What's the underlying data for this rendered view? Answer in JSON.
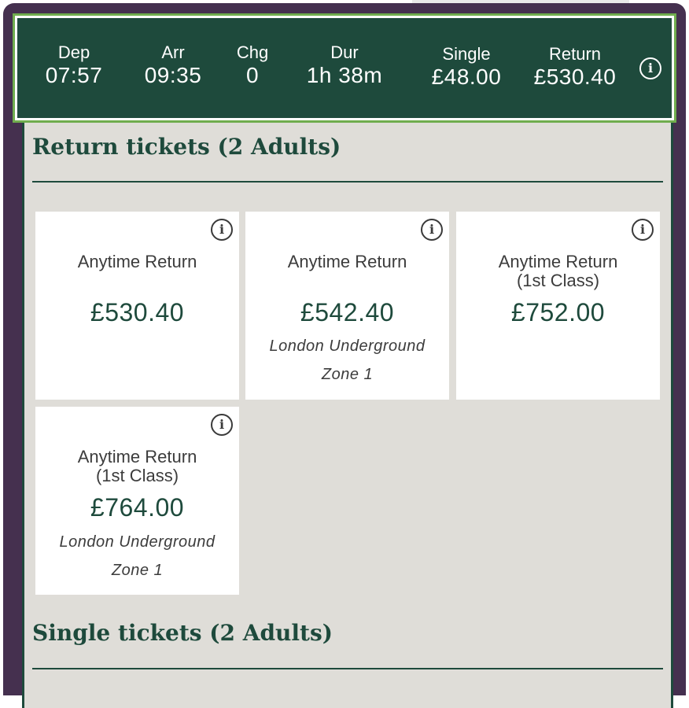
{
  "summary": {
    "dep_label": "Dep",
    "dep_value": "07:57",
    "arr_label": "Arr",
    "arr_value": "09:35",
    "chg_label": "Chg",
    "chg_value": "0",
    "dur_label": "Dur",
    "dur_value": "1h 38m",
    "single_label": "Single",
    "single_value": "£48.00",
    "return_label": "Return",
    "return_value": "£530.40",
    "info_icon": "info-icon"
  },
  "return_section": {
    "title": "Return tickets (2 Adults)",
    "tickets": [
      {
        "name": "Anytime Return",
        "price": "£530.40",
        "note_line1": "",
        "note_line2": ""
      },
      {
        "name": "Anytime Return",
        "price": "£542.40",
        "note_line1": "London Underground",
        "note_line2": "Zone 1"
      },
      {
        "name_line1": "Anytime Return",
        "name_line2": "(1st Class)",
        "price": "£752.00",
        "note_line1": "",
        "note_line2": ""
      },
      {
        "name_line1": "Anytime Return",
        "name_line2": "(1st Class)",
        "price": "£764.00",
        "note_line1": "London Underground",
        "note_line2": "Zone 1"
      }
    ]
  },
  "single_section": {
    "title": "Single tickets (2 Adults)"
  },
  "colors": {
    "brand_green": "#1e4a3c",
    "frame_purple": "#45304f",
    "highlight_green": "#70ad4e",
    "panel_bg": "#dfddd8"
  }
}
